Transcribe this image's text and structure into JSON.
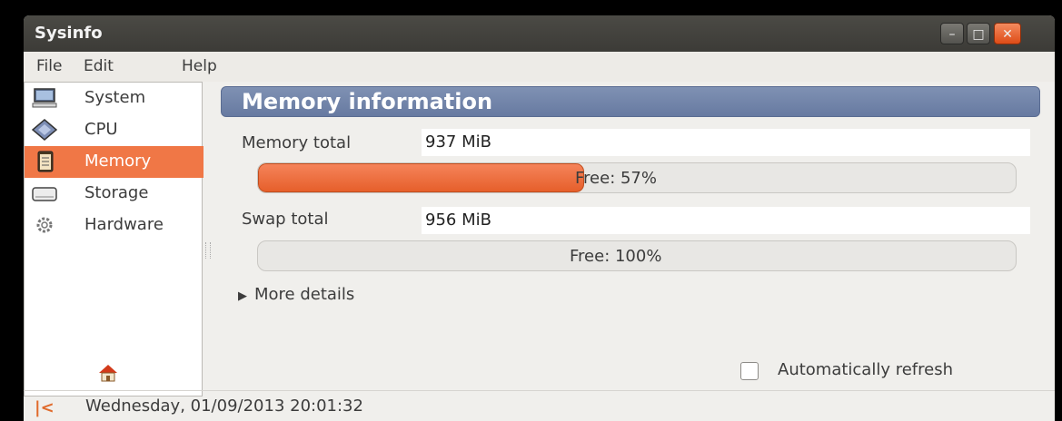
{
  "window": {
    "title": "Sysinfo",
    "controls": {
      "minimize": "–",
      "maximize": "□",
      "close": "✕"
    }
  },
  "menu": [
    "File",
    "Edit",
    "Help"
  ],
  "sidebar": {
    "items": [
      {
        "label": "System",
        "icon": "computer-icon",
        "active": false
      },
      {
        "label": "CPU",
        "icon": "cpu-chip-icon",
        "active": false
      },
      {
        "label": "Memory",
        "icon": "memory-icon",
        "active": true
      },
      {
        "label": "Storage",
        "icon": "hard-drive-icon",
        "active": false
      },
      {
        "label": "Hardware",
        "icon": "gear-icon",
        "active": false
      }
    ]
  },
  "main": {
    "title": "Memory information",
    "memory": {
      "label": "Memory total",
      "value": "937 MiB",
      "bar_text": "Free: 57%",
      "used_fraction": 0.43
    },
    "swap": {
      "label": "Swap total",
      "value": "956 MiB",
      "bar_text": "Free: 100%",
      "used_fraction": 0
    },
    "more_details": "More details",
    "auto_refresh": {
      "label": "Automatically refresh",
      "checked": false
    }
  },
  "status": {
    "timestamp": "Wednesday, 01/09/2013 20:01:32",
    "icon": "first-page-icon"
  },
  "colors": {
    "accent": "#f07746",
    "header": "#7386ab",
    "titlebar": "#3c3b37"
  }
}
